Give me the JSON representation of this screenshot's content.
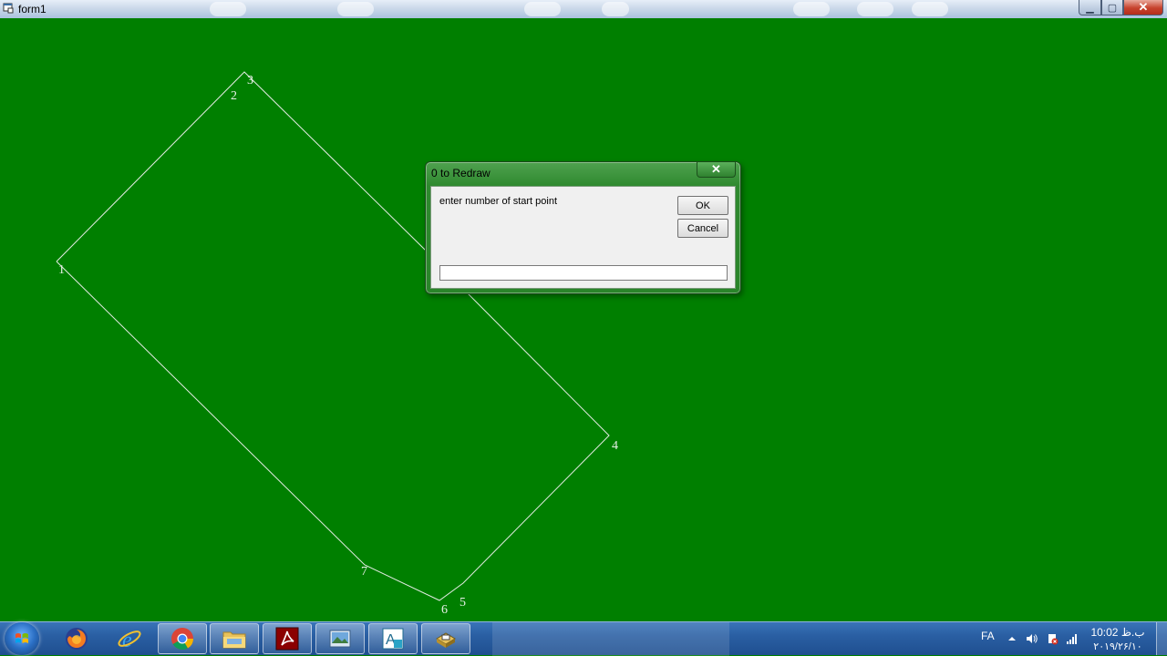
{
  "window": {
    "title": "form1",
    "minimize_label": "▁",
    "maximize_label": "▢",
    "close_label": "✕"
  },
  "drawing": {
    "background": "#007f00",
    "line_color": "#e4ece4",
    "point_labels": [
      "1",
      "2",
      "3",
      "4",
      "5",
      "6",
      "7"
    ]
  },
  "dialog": {
    "title": "0 to Redraw",
    "close_label": "✕",
    "prompt": "enter number of start point",
    "ok_label": "OK",
    "cancel_label": "Cancel",
    "input_value": ""
  },
  "taskbar": {
    "apps": [
      {
        "name": "firefox",
        "icon": "firefox-icon"
      },
      {
        "name": "internet-explorer",
        "icon": "ie-icon"
      },
      {
        "name": "chrome",
        "icon": "chrome-icon"
      },
      {
        "name": "file-explorer",
        "icon": "folder-icon"
      },
      {
        "name": "acrobat",
        "icon": "acrobat-icon"
      },
      {
        "name": "image-viewer",
        "icon": "picture-icon"
      },
      {
        "name": "autocad",
        "icon": "autocad-icon"
      },
      {
        "name": "vb-app",
        "icon": "app-icon"
      }
    ],
    "language": "FA",
    "clock_time": "10:02 ب.ظ",
    "clock_date": "۲۰۱۹/۲۶/۱۰"
  }
}
